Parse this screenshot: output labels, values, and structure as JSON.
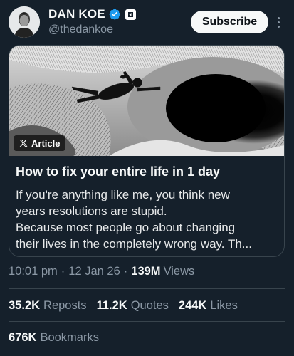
{
  "author": {
    "name": "DAN KOE",
    "handle": "@thedankoe",
    "verified_color": "#1d9bf0"
  },
  "header": {
    "subscribe_label": "Subscribe",
    "more_icon": "more-vertical-icon"
  },
  "article": {
    "badge_label": "Article",
    "title": "How to fix your entire life in 1 day",
    "body_lines": [
      "If you're anything like me, you think new",
      "years resolutions are stupid.",
      "Because most people go about changing",
      "their lives in the completely wrong way. Th..."
    ]
  },
  "meta": {
    "time": "10:01 pm",
    "date": "12 Jan 26",
    "views_count": "139M",
    "views_label": "Views"
  },
  "stats": {
    "reposts_count": "35.2K",
    "reposts_label": "Reposts",
    "quotes_count": "11.2K",
    "quotes_label": "Quotes",
    "likes_count": "244K",
    "likes_label": "Likes",
    "bookmarks_count": "676K",
    "bookmarks_label": "Bookmarks"
  },
  "colors": {
    "background": "#15202b",
    "border": "#38444d",
    "secondary_text": "#8b98a5",
    "primary_text": "#f7f9f9"
  }
}
